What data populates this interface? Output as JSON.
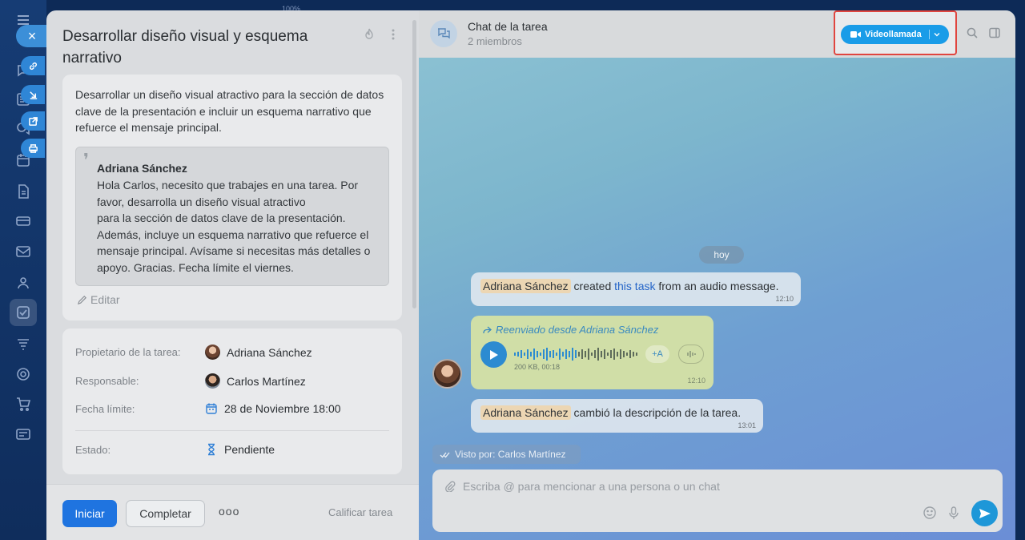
{
  "background": {
    "zoom_text": "100%"
  },
  "task": {
    "title": "Desarrollar diseño visual y esquema narrativo",
    "description": "Desarrollar un diseño visual atractivo para la sección de datos clave de la presentación e incluir un esquema narrativo que refuerce el mensaje principal.",
    "quote": {
      "author": "Adriana Sánchez",
      "line1": "Hola Carlos, necesito que trabajes en una tarea. Por favor, desarrolla un diseño visual atractivo",
      "line2": "para la sección de datos clave de la presentación. Además, incluye un esquema narrativo que refuerce el mensaje principal. Avísame si necesitas más detalles o apoyo. Gracias. Fecha límite el viernes."
    },
    "edit_label": "Editar",
    "fields": {
      "owner_label": "Propietario de la tarea:",
      "owner_value": "Adriana Sánchez",
      "assignee_label": "Responsable:",
      "assignee_value": "Carlos Martínez",
      "deadline_label": "Fecha límite:",
      "deadline_value": "28 de Noviembre 18:00",
      "status_label": "Estado:",
      "status_value": "Pendiente"
    },
    "footer": {
      "start_label": "Iniciar",
      "complete_label": "Completar",
      "more_label": "ooo",
      "rate_label": "Calificar tarea"
    }
  },
  "chat": {
    "title": "Chat de la tarea",
    "subtitle": "2 miembros",
    "video_label": "Videollamada",
    "date_label": "hoy",
    "message1": {
      "author": "Adriana Sánchez",
      "text_before": "created",
      "link": "this task",
      "text_after": "from an audio message.",
      "time": "12:10"
    },
    "voice": {
      "forwarded": "Reenviado desde Adriana Sánchez",
      "meta": "200 KB, 00:18",
      "to_text": "+A",
      "time": "12:10"
    },
    "message3": {
      "author": "Adriana Sánchez",
      "text": "cambió la descripción de la tarea.",
      "time": "13:01"
    },
    "seen": "Visto por: Carlos Martínez",
    "composer_placeholder": "Escriba @ para mencionar a una persona o un chat"
  },
  "colors": {
    "primary": "#1f74e0",
    "video_button": "#1a9ce8",
    "highlight_border": "#e0453f",
    "name_highlight": "#ecd6b3"
  }
}
